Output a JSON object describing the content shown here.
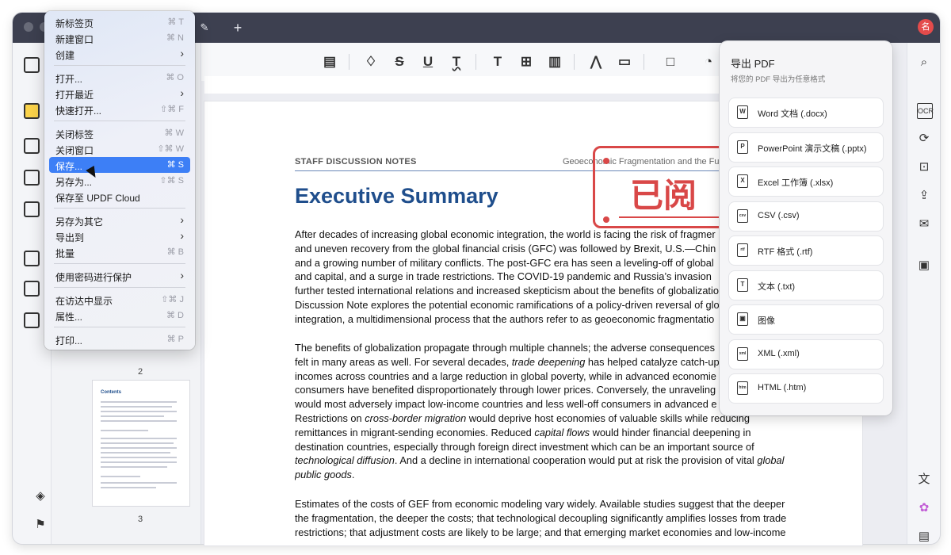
{
  "window": {
    "tab_edit_icon": "pencil-icon",
    "new_tab_symbol": "+",
    "avatar_letter": "名"
  },
  "file_menu": {
    "items": [
      {
        "label": "新标签页",
        "shortcut": "⌘ T"
      },
      {
        "label": "新建窗口",
        "shortcut": "⌘ N"
      },
      {
        "label": "创建",
        "submenu": true
      },
      {
        "label": "打开...",
        "shortcut": "⌘ O"
      },
      {
        "label": "打开最近",
        "submenu": true
      },
      {
        "label": "快速打开...",
        "shortcut": "⇧⌘ F"
      },
      {
        "label": "关闭标签",
        "shortcut": "⌘ W"
      },
      {
        "label": "关闭窗口",
        "shortcut": "⇧⌘ W"
      },
      {
        "label": "保存...",
        "shortcut": "⌘ S",
        "highlighted": true
      },
      {
        "label": "另存为...",
        "shortcut": "⇧⌘ S"
      },
      {
        "label": "保存至 UPDF Cloud"
      },
      {
        "label": "另存为其它",
        "submenu": true
      },
      {
        "label": "导出到",
        "submenu": true
      },
      {
        "label": "批量",
        "shortcut": "⌘ B"
      },
      {
        "label": "使用密码进行保护",
        "submenu": true
      },
      {
        "label": "在访达中显示",
        "shortcut": "⇧⌘ J"
      },
      {
        "label": "属性...",
        "shortcut": "⌘ D"
      },
      {
        "label": "打印...",
        "shortcut": "⌘ P"
      }
    ]
  },
  "thumbnails": {
    "page_2_label": "2",
    "page_3_label": "3",
    "page_3_heading": "Contents"
  },
  "document": {
    "running_head_left": "STAFF DISCUSSION NOTES",
    "running_head_right": "Geoeconomic Fragmentation and the Fut",
    "title": "Executive Summary",
    "paragraph1": [
      "After decades of increasing global economic integration, the world is facing the risk of fragmer",
      "and uneven recovery from the global financial crisis (GFC) was followed by Brexit, U.S.—Chin",
      "and a growing number of military conflicts. The post-GFC era has seen a leveling-off of global",
      "and capital, and a surge in trade restrictions. The COVID-19 pandemic and Russia’s invasion",
      "further tested international relations and increased skepticism about the benefits of globalizatio",
      "Discussion Note explores the potential economic ramifications of a policy-driven reversal of glo",
      "integration, a multidimensional process that the authors refer to as geoeconomic fragmentatio"
    ],
    "paragraph2": [
      [
        "The benefits of globalization propagate through multiple channels; the adverse consequences",
        ""
      ],
      [
        "felt in many areas as well. For several decades, ",
        "trade deepening",
        " has helped catalyze catch-up"
      ],
      [
        "incomes across countries and a large reduction in global poverty, while in advanced economie"
      ],
      [
        "consumers have benefited disproportionately through lower prices. Conversely, the unraveling"
      ],
      [
        "would most adversely impact low-income countries and less well-off consumers in advanced e"
      ],
      [
        "Restrictions on ",
        "cross-border migration",
        " would deprive host economies of valuable skills while reducing"
      ],
      [
        "remittances in migrant-sending economies. Reduced ",
        "capital flows",
        " would hinder financial deepening in"
      ],
      [
        "destination countries, especially through foreign direct investment which can be an important source of"
      ],
      [
        "",
        "technological diffusion",
        ". And a decline in international cooperation would put at risk the provision of vital ",
        "global"
      ],
      [
        "",
        "public goods",
        "."
      ]
    ],
    "paragraph3": [
      "Estimates of the costs of GEF from economic modeling vary widely. Available studies suggest that the deeper",
      "the fragmentation, the deeper the costs; that technological decoupling significantly amplifies losses from trade",
      "restrictions; that adjustment costs are likely to be large; and that emerging market economies and low-income"
    ],
    "stamp_text": "已阅",
    "stamp_color": "#d94848"
  },
  "export_panel": {
    "title": "导出 PDF",
    "subtitle": "将您的 PDF 导出为任意格式",
    "options": [
      {
        "label": "Word 文档 (.docx)",
        "icon": "word-file-icon",
        "glyph": "W"
      },
      {
        "label": "PowerPoint 演示文稿 (.pptx)",
        "icon": "powerpoint-file-icon",
        "glyph": "P"
      },
      {
        "label": "Excel 工作簿 (.xlsx)",
        "icon": "excel-file-icon",
        "glyph": "X"
      },
      {
        "label": "CSV (.csv)",
        "icon": "csv-file-icon",
        "glyph": "csv"
      },
      {
        "label": "RTF 格式 (.rtf)",
        "icon": "rtf-file-icon",
        "glyph": "rtf"
      },
      {
        "label": "文本 (.txt)",
        "icon": "text-file-icon",
        "glyph": "T"
      },
      {
        "label": "图像",
        "icon": "image-file-icon",
        "glyph": "▣"
      },
      {
        "label": "XML (.xml)",
        "icon": "xml-file-icon",
        "glyph": "xml"
      },
      {
        "label": "HTML (.htm)",
        "icon": "html-file-icon",
        "glyph": "htm"
      }
    ]
  },
  "colors": {
    "accent": "#3d7ff6",
    "title_blue": "#1f4e8c",
    "titlebar": "#3d4050"
  }
}
